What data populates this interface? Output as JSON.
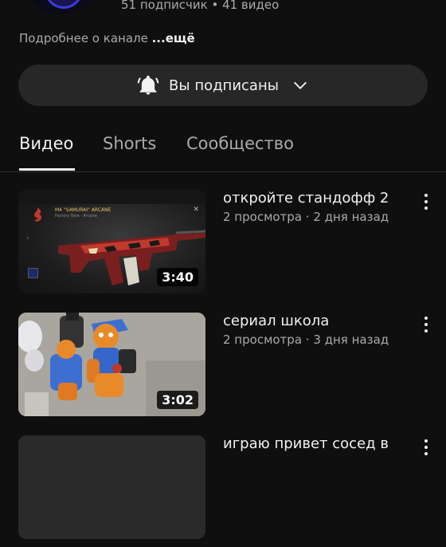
{
  "channel": {
    "stats": "51 подписчик • 41 видео",
    "description_prefix": "Подробнее о канале ",
    "more_label": "...ещё"
  },
  "subscribe": {
    "label": "Вы подписаны",
    "bell_icon": "bell-filled-icon",
    "chevron_icon": "chevron-down-icon"
  },
  "tabs": [
    {
      "label": "Видео",
      "active": true
    },
    {
      "label": "Shorts",
      "active": false
    },
    {
      "label": "Сообщество",
      "active": false
    }
  ],
  "videos": [
    {
      "title": "откройте стандофф 2",
      "meta": "2 просмотра · 2 дня назад",
      "duration": "3:40",
      "thumb_text_title": "M4 \"SAMURAI\"  ARCANE",
      "thumb_text_sub": "Factory New · Arcane"
    },
    {
      "title": "сериал школа",
      "meta": "2 просмотра · 3 дня назад",
      "duration": "3:02"
    },
    {
      "title": "играю привет сосед в",
      "meta": "",
      "duration": ""
    }
  ],
  "colors": {
    "background": "#0f0f0f",
    "button_bg": "#272727",
    "text_primary": "#f1f1f1",
    "text_secondary": "#aaaaaa"
  }
}
